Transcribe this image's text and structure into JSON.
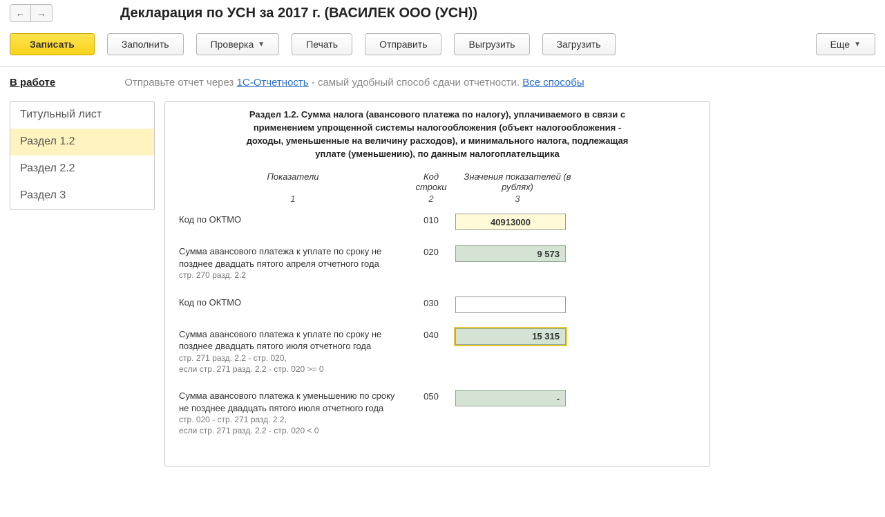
{
  "header": {
    "title": "Декларация по УСН за 2017 г. (ВАСИЛЕК ООО (УСН))"
  },
  "toolbar": {
    "write": "Записать",
    "fill": "Заполнить",
    "check": "Проверка",
    "print": "Печать",
    "send": "Отправить",
    "export": "Выгрузить",
    "import": "Загрузить",
    "more": "Еще"
  },
  "info": {
    "status": "В работе",
    "before": "Отправьте отчет через ",
    "link1": "1С-Отчетность",
    "middle": " - самый удобный способ сдачи отчетности. ",
    "link2": "Все способы"
  },
  "sidebar": {
    "items": [
      {
        "label": "Титульный лист"
      },
      {
        "label": "Раздел 1.2"
      },
      {
        "label": "Раздел 2.2"
      },
      {
        "label": "Раздел 3"
      }
    ],
    "active_index": 1
  },
  "section": {
    "heading": "Раздел 1.2. Сумма налога (авансового платежа по налогу), уплачиваемого в связи с применением упрощенной системы налогообложения (объект налогообложения - доходы, уменьшенные на величину расходов), и минимального налога, подлежащая уплате (уменьшению), по данным налогоплательщика",
    "col_labels": {
      "c1": "Показатели",
      "c2": "Код строки",
      "c3": "Значения показателей (в рублях)"
    },
    "col_nums": {
      "c1": "1",
      "c2": "2",
      "c3": "3"
    },
    "rows": [
      {
        "label": "Код по ОКТМО",
        "sub": "",
        "code": "010",
        "value": "40913000",
        "style": "yellow"
      },
      {
        "label": "Сумма авансового платежа к уплате по сроку не позднее двадцать пятого апреля отчетного года",
        "sub": "стр. 270 разд. 2.2",
        "code": "020",
        "value": "9 573",
        "style": "green"
      },
      {
        "label": "Код по ОКТМО",
        "sub": "",
        "code": "030",
        "value": "",
        "style": "empty"
      },
      {
        "label": "Сумма  авансового платежа к уплате по сроку не позднее двадцать пятого июля отчетного года",
        "sub": "стр. 271 разд. 2.2 - стр. 020,\nесли стр. 271 разд. 2.2 - стр. 020 >= 0",
        "code": "040",
        "value": "15 315",
        "style": "green highlight"
      },
      {
        "label": "Сумма авансового платежа к уменьшению по сроку не позднее двадцать пятого июля отчетного года",
        "sub": "стр. 020 - стр. 271 разд. 2.2,\nесли стр. 271 разд. 2.2 - стр. 020 < 0",
        "code": "050",
        "value": "-",
        "style": "green"
      }
    ]
  }
}
